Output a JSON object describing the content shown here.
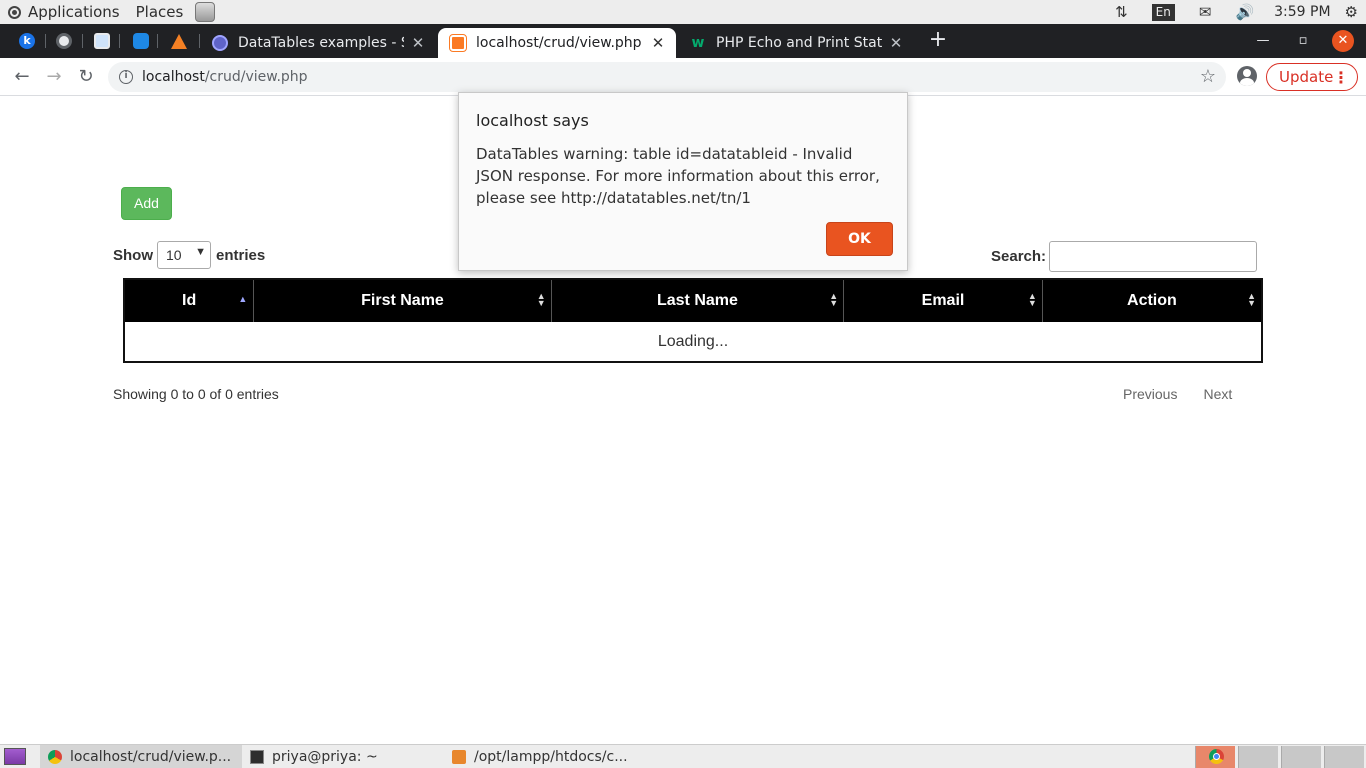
{
  "desktop": {
    "applications_label": "Applications",
    "places_label": "Places",
    "keyboard_layout": "En",
    "clock": "3:59 PM"
  },
  "browser": {
    "tabs": [
      {
        "title": "DataTables examples - Server-side processing"
      },
      {
        "title": "localhost/crud/view.php"
      },
      {
        "title": "PHP Echo and Print Statements"
      }
    ],
    "url_host": "localhost",
    "url_path": "/crud/view.php",
    "update_label": "Update"
  },
  "page": {
    "add_label": "Add",
    "show_label": "Show",
    "entries_label": "entries",
    "page_length": "10",
    "search_label": "Search:",
    "search_value": "",
    "columns": [
      "Id",
      "First Name",
      "Last Name",
      "Email",
      "Action"
    ],
    "loading_text": "Loading...",
    "info_text": "Showing 0 to 0 of 0 entries",
    "previous_label": "Previous",
    "next_label": "Next"
  },
  "dialog": {
    "title": "localhost says",
    "message": "DataTables warning: table id=datatableid - Invalid JSON response. For more information about this error, please see http://datatables.net/tn/1",
    "ok_label": "OK"
  },
  "taskbar": {
    "items": [
      {
        "label": "localhost/crud/view.p..."
      },
      {
        "label": "priya@priya: ~"
      },
      {
        "label": "/opt/lampp/htdocs/c..."
      }
    ]
  },
  "colors": {
    "accent": "#e95420",
    "add_button": "#5cb85c",
    "table_header": "#000000"
  }
}
